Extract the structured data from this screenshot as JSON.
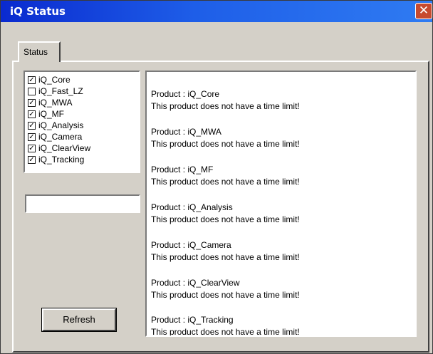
{
  "window": {
    "title": "iQ Status",
    "close_glyph": "✕",
    "titlebar_color": "#0A2ACF"
  },
  "tabs": [
    {
      "label": "Status",
      "selected": true
    }
  ],
  "products": [
    {
      "label": "iQ_Core",
      "checked": true
    },
    {
      "label": "iQ_Fast_LZ",
      "checked": false
    },
    {
      "label": "iQ_MWA",
      "checked": true
    },
    {
      "label": "iQ_MF",
      "checked": true
    },
    {
      "label": "iQ_Analysis",
      "checked": true
    },
    {
      "label": "iQ_Camera",
      "checked": true
    },
    {
      "label": "iQ_ClearView",
      "checked": true
    },
    {
      "label": "iQ_Tracking",
      "checked": true
    }
  ],
  "input": {
    "value": ""
  },
  "refresh_button": {
    "label": "Refresh"
  },
  "status_entries": [
    {
      "product": "Product : iQ_Core",
      "message": "This product does not have a time limit!"
    },
    {
      "product": "Product : iQ_MWA",
      "message": "This product does not have a time limit!"
    },
    {
      "product": "Product : iQ_MF",
      "message": "This product does not have a time limit!"
    },
    {
      "product": "Product : iQ_Analysis",
      "message": "This product does not have a time limit!"
    },
    {
      "product": "Product : iQ_Camera",
      "message": "This product does not have a time limit!"
    },
    {
      "product": "Product : iQ_ClearView",
      "message": "This product does not have a time limit!"
    },
    {
      "product": "Product : iQ_Tracking",
      "message": "This product does not have a time limit!"
    }
  ]
}
